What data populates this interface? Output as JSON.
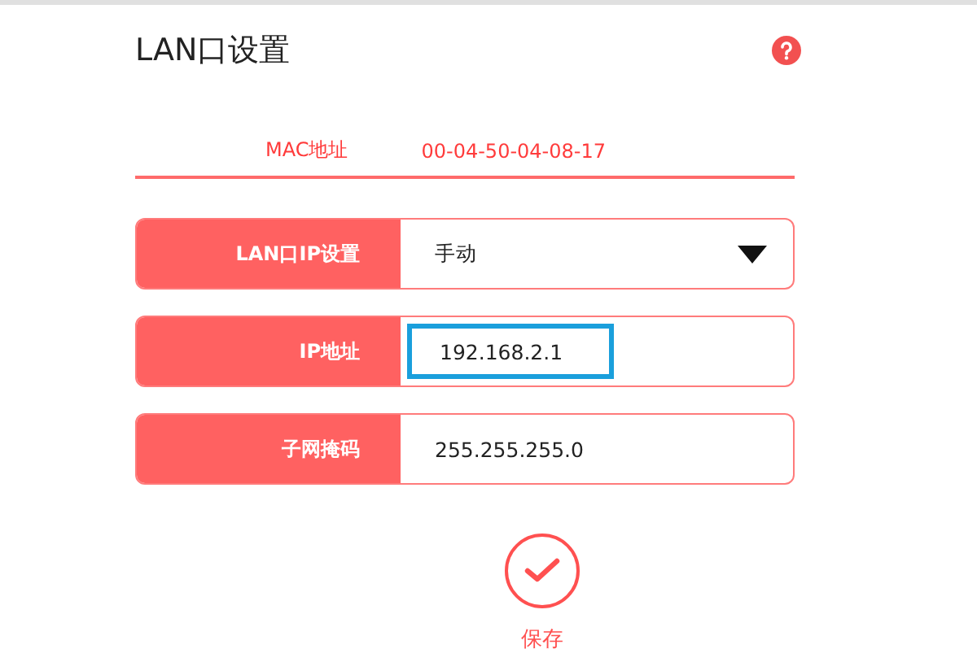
{
  "title": "LAN口设置",
  "mac": {
    "label": "MAC地址",
    "value": "00-04-50-04-08-17"
  },
  "fields": [
    {
      "kind": "select",
      "label": "LAN口IP设置",
      "value": "手动",
      "highlighted": false
    },
    {
      "kind": "input",
      "label": "IP地址",
      "value": "192.168.2.1",
      "highlighted": true
    },
    {
      "kind": "input",
      "label": "子网掩码",
      "value": "255.255.255.0",
      "highlighted": false
    }
  ],
  "save": {
    "label": "保存"
  }
}
